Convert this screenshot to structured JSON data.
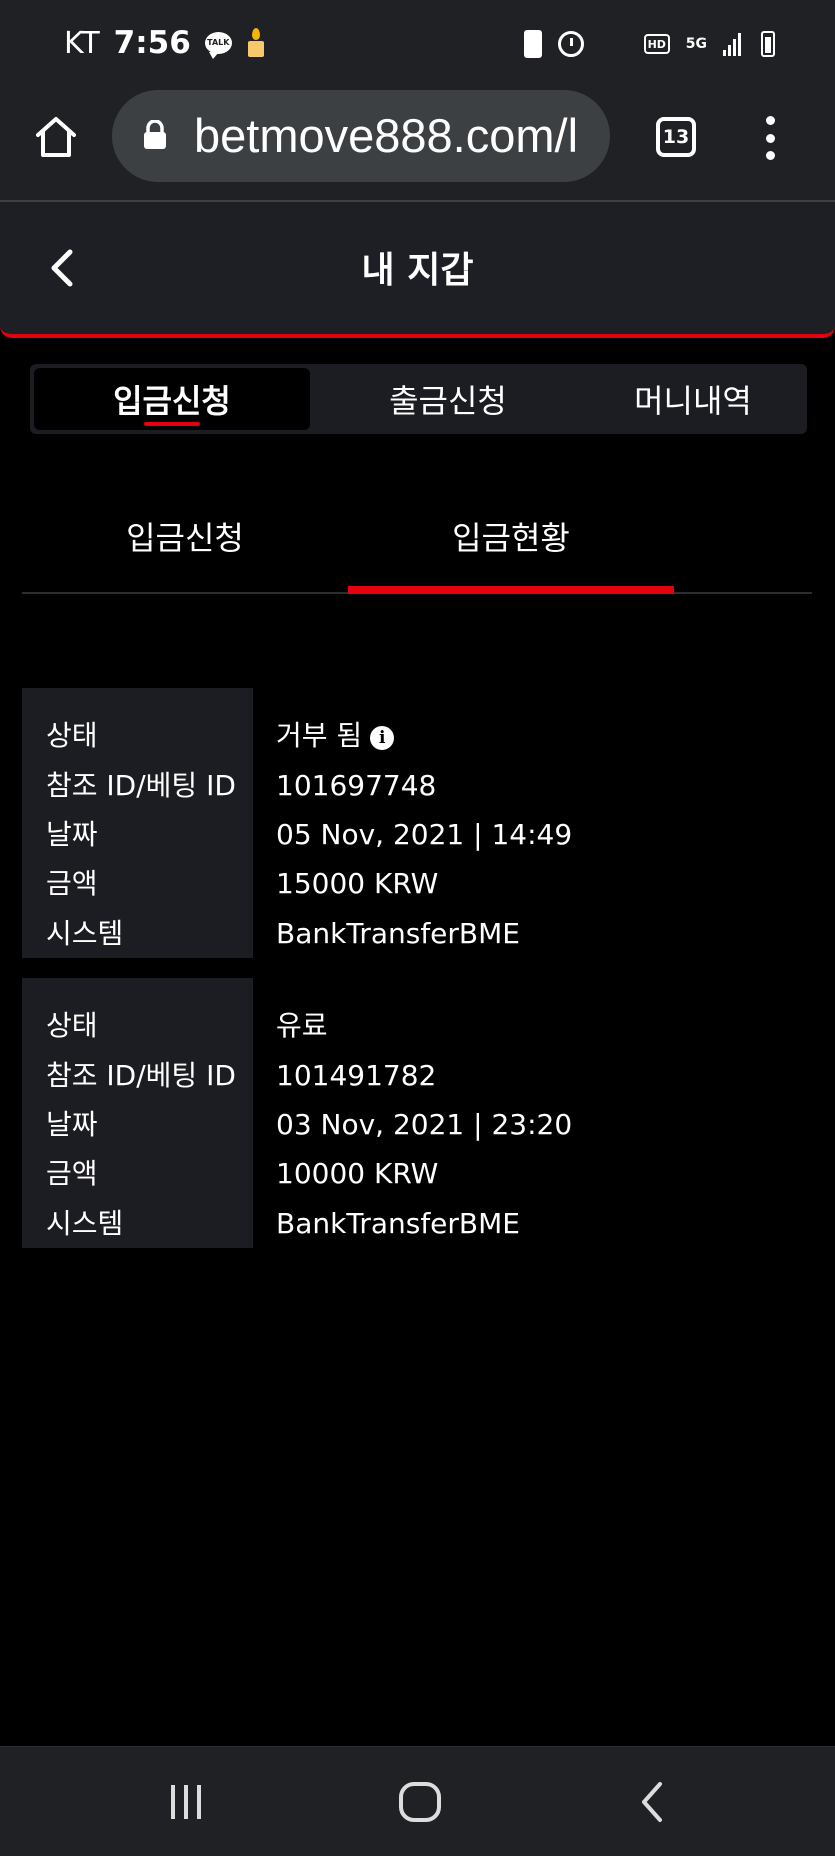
{
  "status_bar": {
    "carrier": "KT",
    "time": "7:56",
    "talk_badge": "TALK",
    "hd_label": "HD",
    "network": "5G"
  },
  "browser": {
    "url": "betmove888.com/l",
    "tab_count": "13"
  },
  "header": {
    "title": "내 지갑"
  },
  "main_tabs": [
    {
      "label": "입금신청",
      "active": true
    },
    {
      "label": "출금신청",
      "active": false
    },
    {
      "label": "머니내역",
      "active": false
    }
  ],
  "sub_tabs": [
    {
      "label": "입금신청",
      "active": false
    },
    {
      "label": "입금현황",
      "active": true
    }
  ],
  "records": [
    {
      "labels": [
        "상태",
        "참조 ID/베팅 ID",
        "날짜",
        "금액",
        "시스템"
      ],
      "status": "거부 됨",
      "reference_id": "101697748",
      "date": "05 Nov, 2021 | 14:49",
      "amount": "15000 KRW",
      "system": "BankTransferBME"
    },
    {
      "labels": [
        "상태",
        "참조 ID/베팅 ID",
        "날짜",
        "금액",
        "시스템"
      ],
      "status": "유료",
      "reference_id": "101491782",
      "date": "03 Nov, 2021 | 23:20",
      "amount": "10000 KRW",
      "system": "BankTransferBME"
    }
  ],
  "colors": {
    "accent": "#e3000f",
    "background": "#000000",
    "panel": "#1c1d22",
    "chrome": "#202124"
  }
}
